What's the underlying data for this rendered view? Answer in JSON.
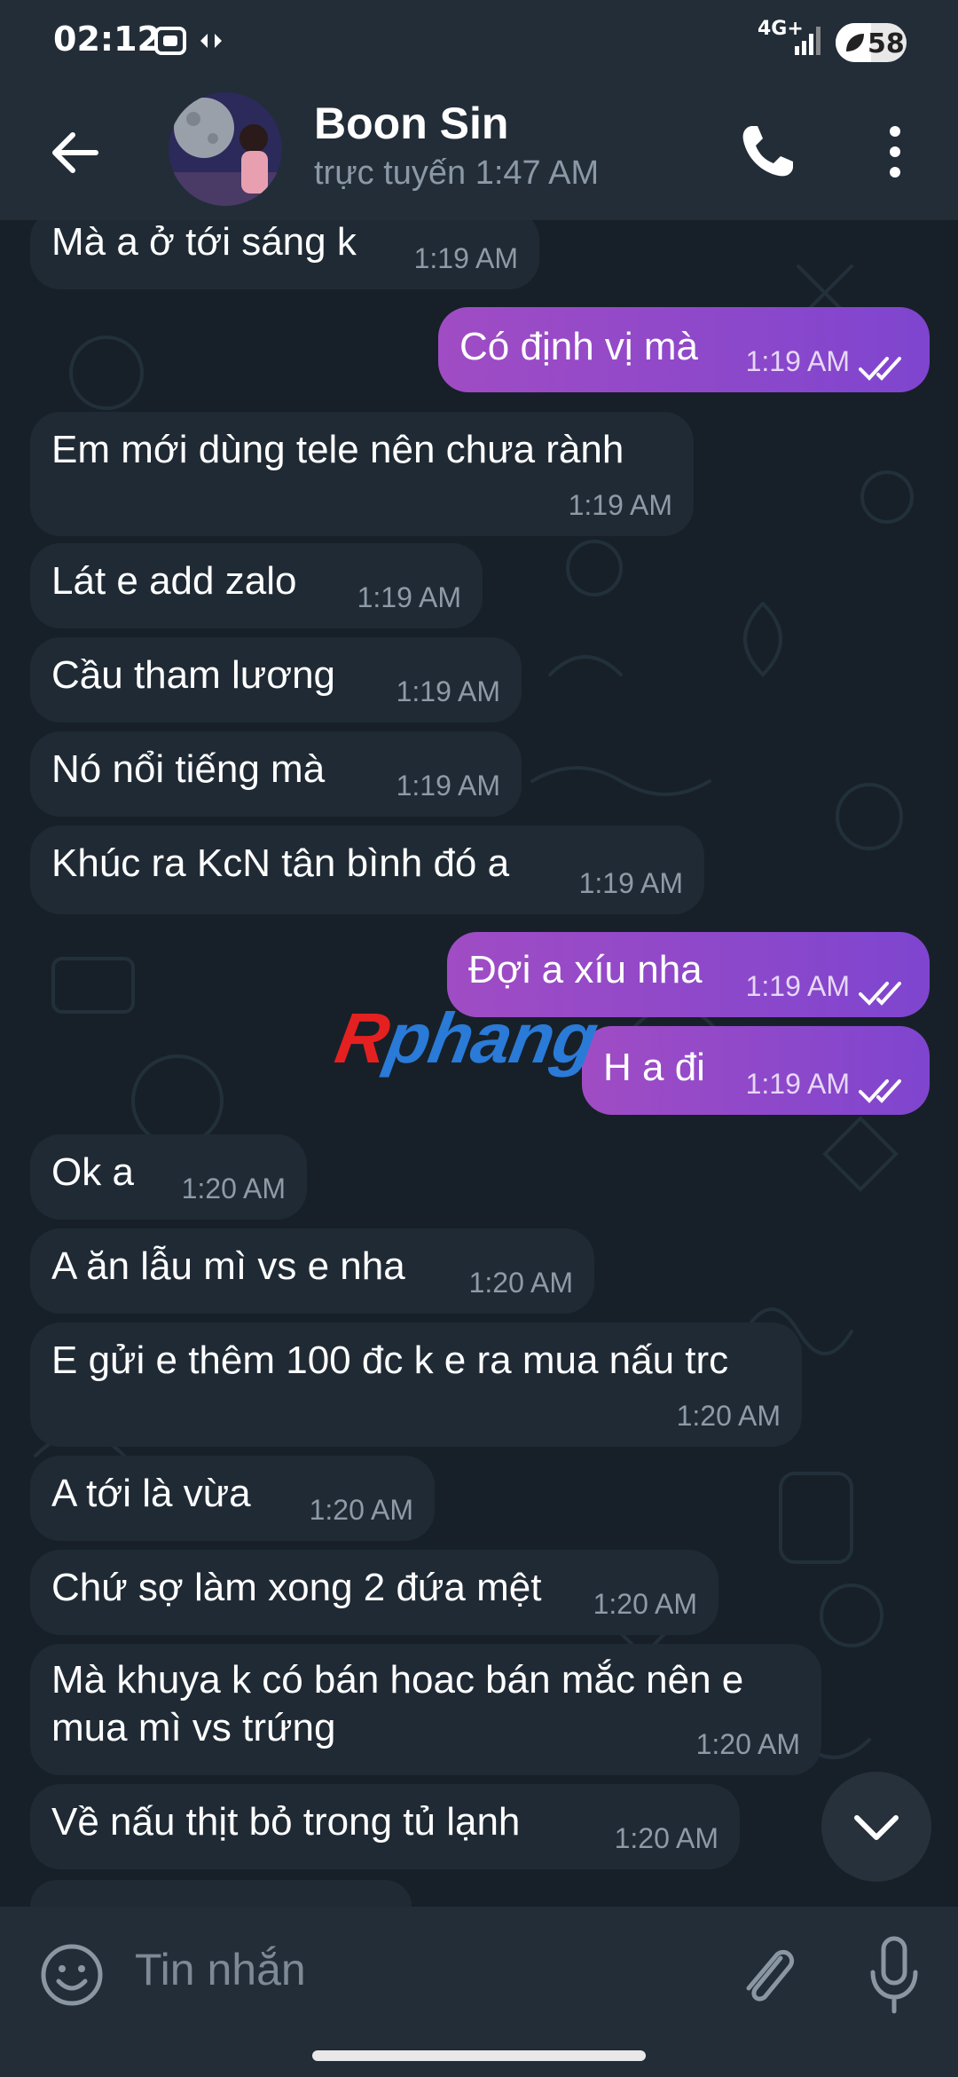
{
  "status_bar": {
    "time": "02:12",
    "network": "4G+",
    "battery": "58"
  },
  "header": {
    "name": "Boon Sin",
    "status": "trực tuyến 1:47 AM"
  },
  "messages": [
    {
      "text": "Mà a ở tới sáng k",
      "time": "1:19 AM"
    },
    {
      "text": "Có định vị mà",
      "time": "1:19 AM"
    },
    {
      "text": "Em mới dùng tele nên chưa rành",
      "time": "1:19 AM"
    },
    {
      "text": "Lát e add zalo",
      "time": "1:19 AM"
    },
    {
      "text": "Cầu tham lương",
      "time": "1:19 AM"
    },
    {
      "text": "Nó nổi tiếng mà",
      "time": "1:19 AM"
    },
    {
      "text": "Khúc ra KcN tân bình đó a",
      "time": "1:19 AM"
    },
    {
      "text": "Đợi a xíu nha",
      "time": "1:19 AM"
    },
    {
      "text": "H a đi",
      "time": "1:19 AM"
    },
    {
      "text": "Ok a",
      "time": "1:20 AM"
    },
    {
      "text": "A ăn lẫu mì vs e nha",
      "time": "1:20 AM"
    },
    {
      "text": "E gửi e thêm 100 đc k e ra mua nấu trc",
      "time": "1:20 AM"
    },
    {
      "text": "A tới là vừa",
      "time": "1:20 AM"
    },
    {
      "text": "Chứ sợ làm xong 2 đứa mệt",
      "time": "1:20 AM"
    },
    {
      "text": "Mà khuya k có bán hoac bán mắc nên e",
      "text2": "mua mì vs trứng",
      "time": "1:20 AM"
    },
    {
      "text": "Về nấu thịt bỏ trong tủ lạnh",
      "time": "1:20 AM"
    }
  ],
  "watermark": {
    "first": "R",
    "rest": "phang"
  },
  "input": {
    "placeholder": "Tin nhắn"
  },
  "icons": [
    "back-arrow-icon",
    "phone-icon",
    "more-vert-icon",
    "emoji-icon",
    "attach-icon",
    "mic-icon",
    "chevron-down-icon",
    "double-check-icon"
  ],
  "colors": {
    "background": "#172028",
    "bar": "#222d38",
    "incoming": "#1f2a34",
    "outgoing": "#9549c6"
  }
}
